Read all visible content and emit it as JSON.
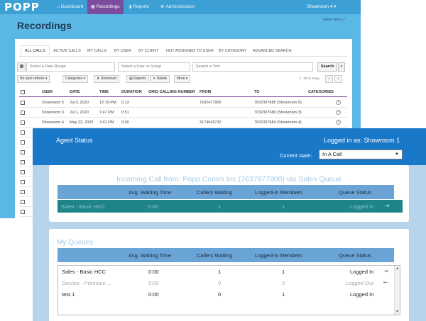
{
  "recordings": {
    "logo": "POPP",
    "nav": [
      {
        "icon": "⌂",
        "label": "Dashboard"
      },
      {
        "icon": "▦",
        "label": "Recordings"
      },
      {
        "icon": "▮",
        "label": "Reports"
      },
      {
        "icon": "⚙",
        "label": "Administration"
      }
    ],
    "user": "Showroom 4 ▾",
    "title": "Recordings",
    "wide_view": "Wide view ⤢",
    "tabs": [
      "ALL CALLS",
      "ACTIVE CALLS",
      "MY CALLS",
      "BY USER",
      "BY CLIENT",
      "NOT ASSIGNED TO USER",
      "BY CATEGORY",
      "ADVANCED SEARCH"
    ],
    "filters": {
      "date_placeholder": "Select a Date Range",
      "user_placeholder": "Select a User or Group",
      "text_placeholder": "Search a Text",
      "search_label": "Search"
    },
    "toolbar": {
      "auto_refresh": "No auto refresh ▾",
      "categories": "Categories ▾",
      "download": "⬇ Download",
      "reports": "▤ Reports",
      "delete": "✕ Delete",
      "more": "More ▾",
      "counter": "1 - 30 of many"
    },
    "columns": [
      "USER",
      "DATE",
      "TIME",
      "DURATION",
      "ORIG CALLING NUMBER",
      "FROM",
      "TO",
      "CATEGORIES"
    ],
    "rows": [
      {
        "user": "Showroom 5",
        "date": "Jul 3, 2020",
        "time": "12:19 PM",
        "duration": "0:13",
        "from": "7632477905",
        "to": "7632337685 (Showroom 5)"
      },
      {
        "user": "Showroom 3",
        "date": "Jul 1, 2020",
        "time": "7:47 PM",
        "duration": "0:51",
        "from": "",
        "to": "7632337686 (Showroom 3)"
      },
      {
        "user": "Showroom 4",
        "date": "May 22, 2020",
        "time": "2:41 PM",
        "duration": "0:40",
        "from": "3174643732",
        "to": "7632337684 (Showroom 4)"
      }
    ]
  },
  "agent": {
    "title": "Agent Status",
    "logged_in_as": "Logged in as: Showroom 1",
    "state_label": "Current state:",
    "state_value": "In A Call",
    "incoming_title": "Incoming Call from: Popp Comm Inc (7637977900) via Sales Queue",
    "queue_headers": [
      "Avg. Waiting Time",
      "Callers Waiting",
      "Logged-in Members",
      "Queue Status"
    ],
    "active_queue": {
      "name": "Sales - Basic HCC",
      "avg": "0:00",
      "waiting": "1",
      "members": "1",
      "status": "Logged In"
    },
    "my_queues_title": "My Queues",
    "queues": [
      {
        "name": "Sales - Basic HCC",
        "avg": "0:00",
        "waiting": "1",
        "members": "1",
        "status": "Logged In"
      },
      {
        "name": "Service - Premium ...",
        "avg": "0:00",
        "waiting": "0",
        "members": "0",
        "status": "Logged Out"
      },
      {
        "name": "test 1",
        "avg": "0:00",
        "waiting": "0",
        "members": "1",
        "status": "Logged In"
      }
    ]
  },
  "colors": {
    "nav": "#3da0d4",
    "active_nav": "#7c4d9e",
    "header": "#1a78c8",
    "active_queue": "#1f838a",
    "table_head": "#6aa3d5"
  }
}
